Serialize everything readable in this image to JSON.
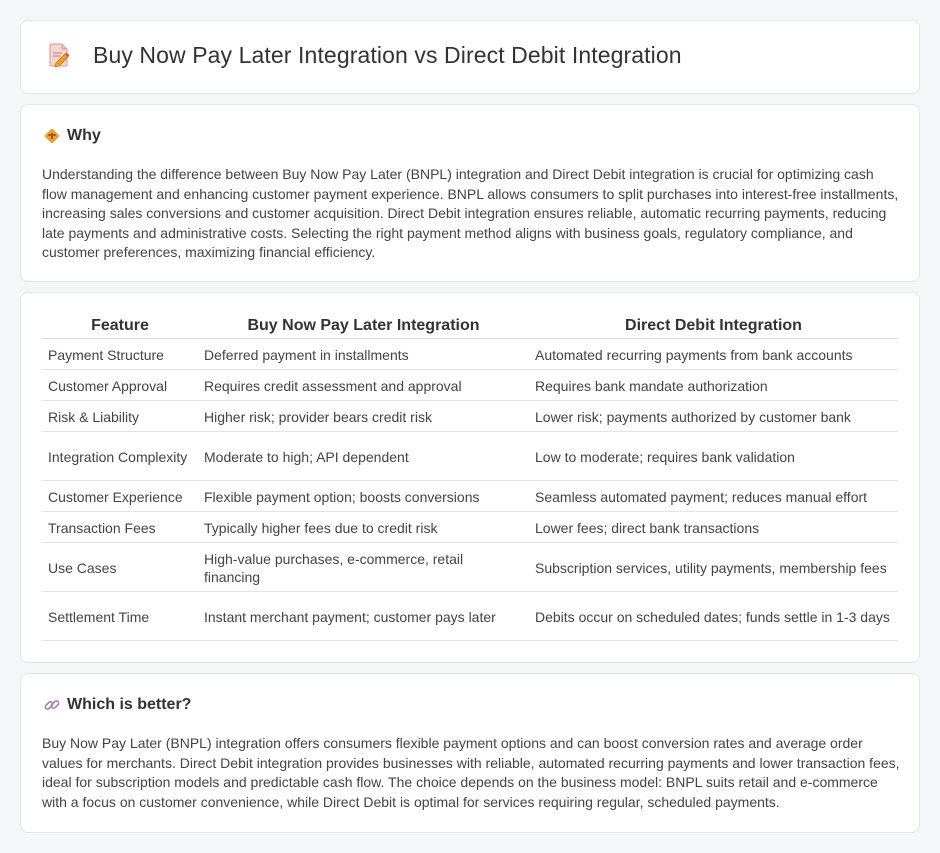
{
  "header": {
    "title": "Buy Now Pay Later Integration vs Direct Debit Integration",
    "icon": "document-pen-icon"
  },
  "why": {
    "icon": "diamond-sign-icon",
    "title": "Why",
    "body": "Understanding the difference between Buy Now Pay Later (BNPL) integration and Direct Debit integration is crucial for optimizing cash flow management and enhancing customer payment experience. BNPL allows consumers to split purchases into interest-free installments, increasing sales conversions and customer acquisition. Direct Debit integration ensures reliable, automatic recurring payments, reducing late payments and administrative costs. Selecting the right payment method aligns with business goals, regulatory compliance, and customer preferences, maximizing financial efficiency."
  },
  "comparison": {
    "headers": [
      "Feature",
      "Buy Now Pay Later Integration",
      "Direct Debit Integration"
    ],
    "rows": [
      [
        "Payment Structure",
        "Deferred payment in installments",
        "Automated recurring payments from bank accounts"
      ],
      [
        "Customer Approval",
        "Requires credit assessment and approval",
        "Requires bank mandate authorization"
      ],
      [
        "Risk & Liability",
        "Higher risk; provider bears credit risk",
        "Lower risk; payments authorized by customer bank"
      ],
      [
        "Integration Complexity",
        "Moderate to high; API dependent",
        "Low to moderate; requires bank validation"
      ],
      [
        "Customer Experience",
        "Flexible payment option; boosts conversions",
        "Seamless automated payment; reduces manual effort"
      ],
      [
        "Transaction Fees",
        "Typically higher fees due to credit risk",
        "Lower fees; direct bank transactions"
      ],
      [
        "Use Cases",
        "High-value purchases, e-commerce, retail financing",
        "Subscription services, utility payments, membership fees"
      ],
      [
        "Settlement Time",
        "Instant merchant payment; customer pays later",
        "Debits occur on scheduled dates; funds settle in 1-3 days"
      ]
    ]
  },
  "better": {
    "icon": "link-icon",
    "title": "Which is better?",
    "body": "Buy Now Pay Later (BNPL) integration offers consumers flexible payment options and can boost conversion rates and average order values for merchants. Direct Debit integration provides businesses with reliable, automated recurring payments and lower transaction fees, ideal for subscription models and predictable cash flow. The choice depends on the business model: BNPL suits retail and e-commerce with a focus on customer convenience, while Direct Debit is optimal for services requiring regular, scheduled payments."
  }
}
